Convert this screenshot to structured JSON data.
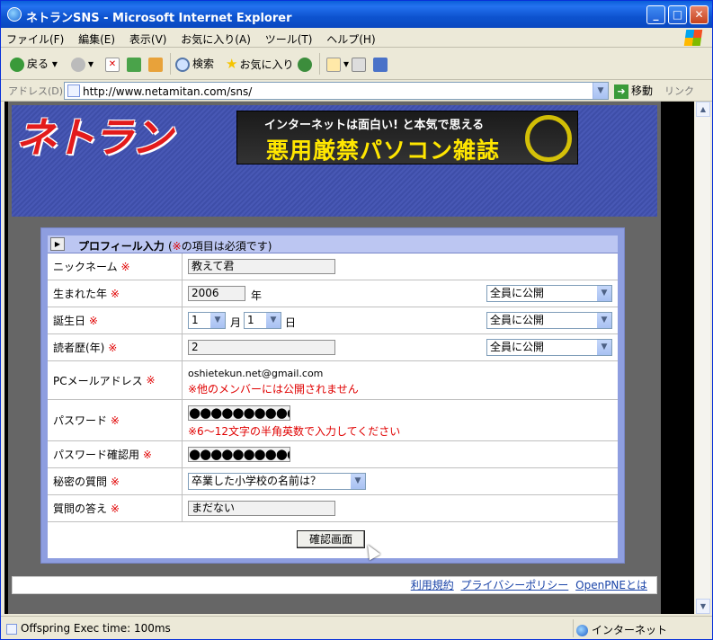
{
  "window": {
    "title": "ネトランSNS - Microsoft Internet Explorer"
  },
  "menu": [
    "ファイル(F)",
    "編集(E)",
    "表示(V)",
    "お気に入り(A)",
    "ツール(T)",
    "ヘルプ(H)"
  ],
  "toolbar": {
    "back": "戻る",
    "search": "検索",
    "favorites": "お気に入り"
  },
  "address": {
    "label": "アドレス(D)",
    "url": "http://www.netamitan.com/sns/",
    "go": "移動",
    "links": "リンク"
  },
  "banner": {
    "logo": "ネトラン",
    "ad_line1": "インターネットは面白い! と本気で思える",
    "ad_line2": "悪用厳禁パソコン雑誌"
  },
  "form": {
    "title": "プロフィール入力",
    "note_open": "(",
    "note_mark": "※",
    "note_text": "の項目は必須です)",
    "req": "※",
    "rows": {
      "nickname": {
        "label": "ニックネーム",
        "value": "教えて君"
      },
      "birth_year": {
        "label": "生まれた年",
        "value": "2006",
        "unit": "年",
        "privacy": "全員に公開"
      },
      "birthday": {
        "label": "誕生日",
        "month": "1",
        "month_unit": "月",
        "day": "1",
        "day_unit": "日",
        "privacy": "全員に公開"
      },
      "reader": {
        "label": "読者歴(年)",
        "value": "2",
        "privacy": "全員に公開"
      },
      "email": {
        "label": "PCメールアドレス",
        "value": "oshietekun.net@gmail.com",
        "note": "※他のメンバーには公開されません"
      },
      "password": {
        "label": "パスワード",
        "value": "●●●●●●●●●●",
        "note": "※6～12文字の半角英数で入力してください"
      },
      "password_confirm": {
        "label": "パスワード確認用",
        "value": "●●●●●●●●●●"
      },
      "secret_q": {
        "label": "秘密の質問",
        "value": "卒業した小学校の名前は？"
      },
      "secret_a": {
        "label": "質問の答え",
        "value": "まだない"
      }
    },
    "submit": "確認画面"
  },
  "footer": {
    "terms": "利用規約",
    "privacy": "プライバシーポリシー",
    "about": "OpenPNEとは"
  },
  "status": {
    "text": "Offspring Exec time: 100ms",
    "zone": "インターネット"
  }
}
